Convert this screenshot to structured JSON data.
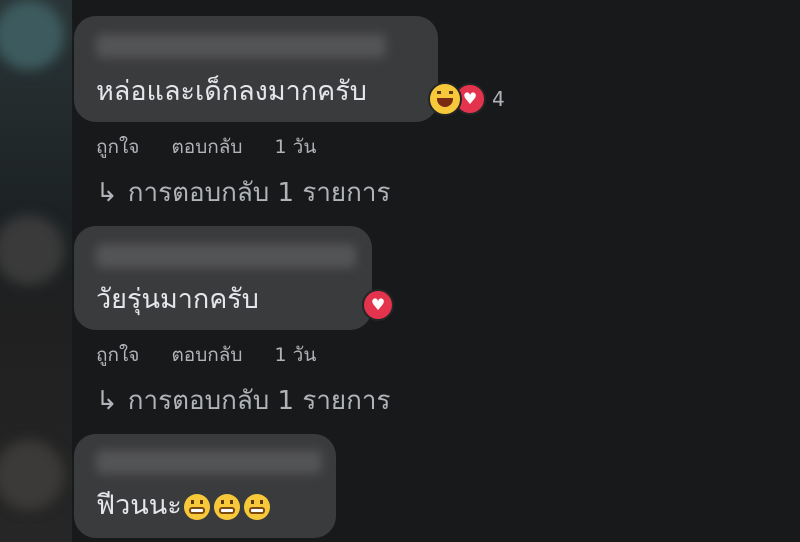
{
  "comments": [
    {
      "text": "หล่อและเด็กลงมากครับ",
      "reaction_count": "4",
      "reaction_icons": [
        "haha-icon",
        "love-icon"
      ],
      "actions": {
        "like": "ถูกใจ",
        "reply": "ตอบกลับ",
        "time": "1 วัน"
      },
      "replies_label": "การตอบกลับ 1 รายการ"
    },
    {
      "text": "วัยรุ่นมากครับ",
      "reaction_icons": [
        "love-icon"
      ],
      "actions": {
        "like": "ถูกใจ",
        "reply": "ตอบกลับ",
        "time": "1 วัน"
      },
      "replies_label": "การตอบกลับ 1 รายการ"
    },
    {
      "text": "ฟีวนนะ",
      "emojis": [
        "grin-icon",
        "grin-icon",
        "grin-icon"
      ]
    }
  ],
  "colors": {
    "background": "#18191a",
    "bubble": "#3a3b3c",
    "text": "#e4e6eb",
    "secondary_text": "#b0b3b8",
    "love": "#e4334d"
  }
}
